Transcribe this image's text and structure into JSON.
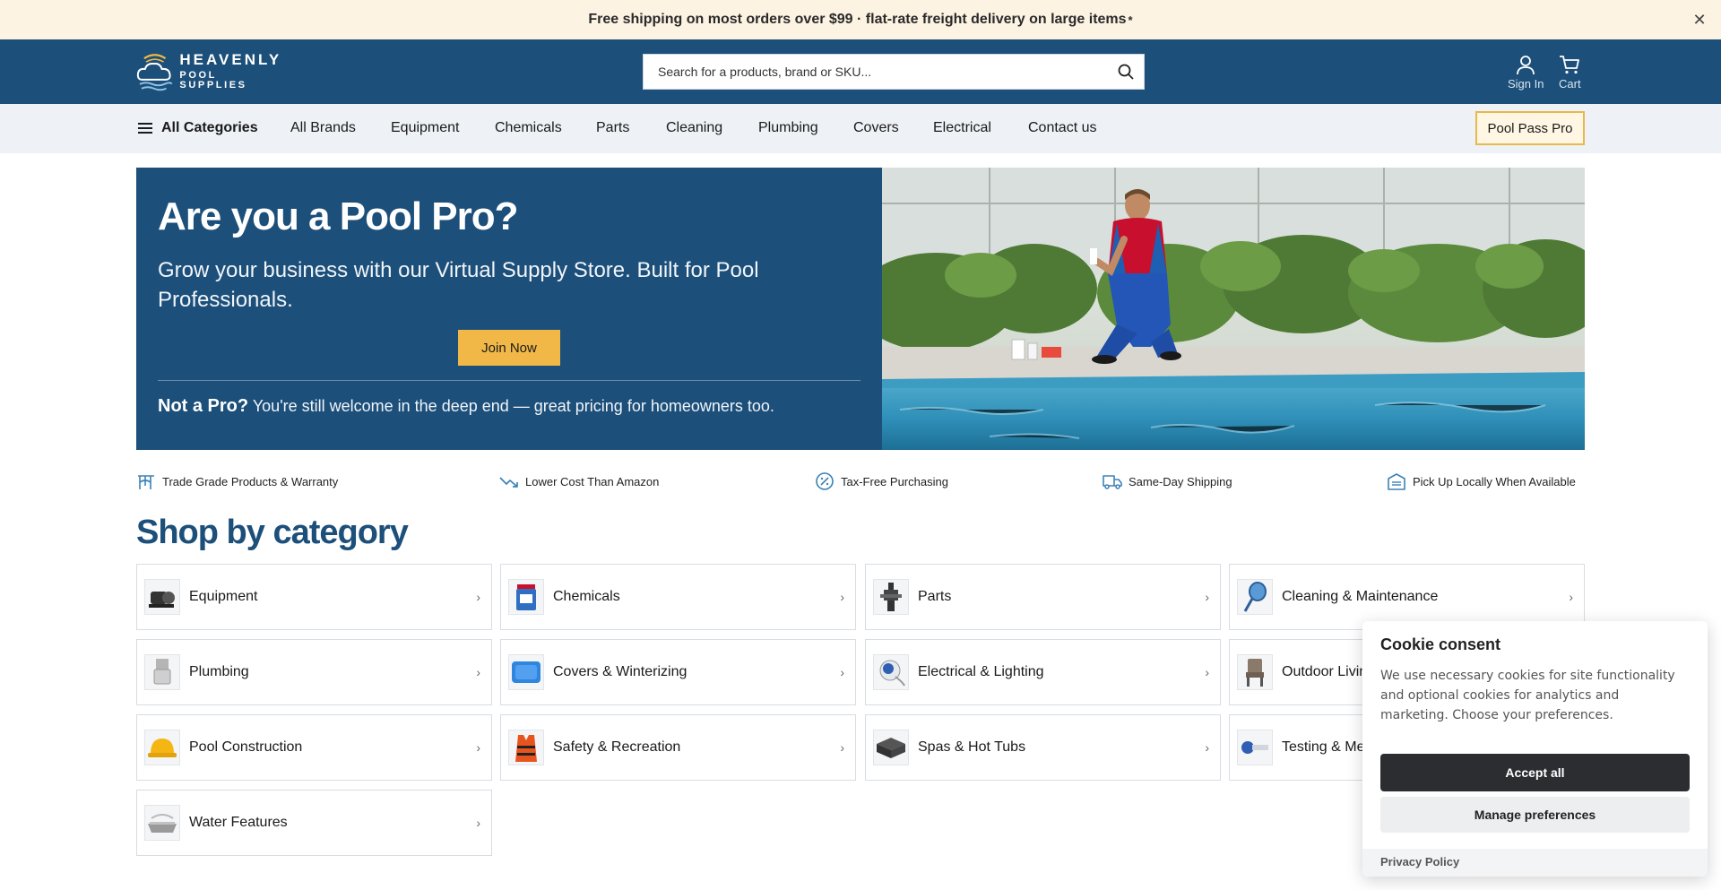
{
  "promo": {
    "text": "Free shipping on most orders over $99 · flat-rate freight delivery on large items",
    "asterisk": "*",
    "close_icon": "close-icon"
  },
  "header": {
    "logo_line1": "HEAVENLY",
    "logo_line2": "POOL SUPPLIES",
    "search_placeholder": "Search for a products, brand or SKU...",
    "sign_in": "Sign In",
    "cart": "Cart"
  },
  "nav": {
    "all_categories": "All Categories",
    "items": [
      "All Brands",
      "Equipment",
      "Chemicals",
      "Parts",
      "Cleaning",
      "Plumbing",
      "Covers",
      "Electrical",
      "Contact us"
    ],
    "pro_button": "Pool Pass Pro"
  },
  "hero": {
    "title": "Are you a Pool Pro?",
    "subtitle": "Grow your business with our Virtual Supply Store. Built for Pool Professionals.",
    "join_button": "Join Now",
    "note_bold": "Not a Pro?",
    "note_text": "You're still welcome in the deep end — great pricing for homeowners too."
  },
  "features": [
    {
      "label": "Trade Grade Products & Warranty",
      "icon": "trade-grade-icon"
    },
    {
      "label": "Lower Cost Than Amazon",
      "icon": "trend-down-icon"
    },
    {
      "label": "Tax-Free Purchasing",
      "icon": "tax-free-icon"
    },
    {
      "label": "Same-Day Shipping",
      "icon": "truck-icon"
    },
    {
      "label": "Pick Up Locally When Available",
      "icon": "store-icon"
    }
  ],
  "section_title": "Shop by category",
  "categories": [
    {
      "label": "Equipment",
      "icon": "pump-icon"
    },
    {
      "label": "Chemicals",
      "icon": "chemical-bucket-icon"
    },
    {
      "label": "Parts",
      "icon": "valve-part-icon"
    },
    {
      "label": "Cleaning & Maintenance",
      "icon": "skimmer-net-icon"
    },
    {
      "label": "Plumbing",
      "icon": "pipe-fitting-icon"
    },
    {
      "label": "Covers & Winterizing",
      "icon": "cover-icon"
    },
    {
      "label": "Electrical & Lighting",
      "icon": "pool-light-icon"
    },
    {
      "label": "Outdoor Living",
      "icon": "chair-icon"
    },
    {
      "label": "Pool Construction",
      "icon": "hard-hat-icon"
    },
    {
      "label": "Safety & Recreation",
      "icon": "life-vest-icon"
    },
    {
      "label": "Spas & Hot Tubs",
      "icon": "hot-tub-icon"
    },
    {
      "label": "Testing & Measurement",
      "icon": "test-probe-icon"
    },
    {
      "label": "Water Features",
      "icon": "fountain-icon"
    }
  ],
  "cookie": {
    "title": "Cookie consent",
    "body": "We use necessary cookies for site functionality and optional cookies for analytics and marketing. Choose your preferences.",
    "accept": "Accept all",
    "manage": "Manage preferences",
    "privacy": "Privacy Policy"
  },
  "colors": {
    "brand_blue": "#1c4f7a",
    "accent_yellow": "#f2b847",
    "promo_bg": "#fdf3e3",
    "nav_bg": "#eef1f5"
  }
}
